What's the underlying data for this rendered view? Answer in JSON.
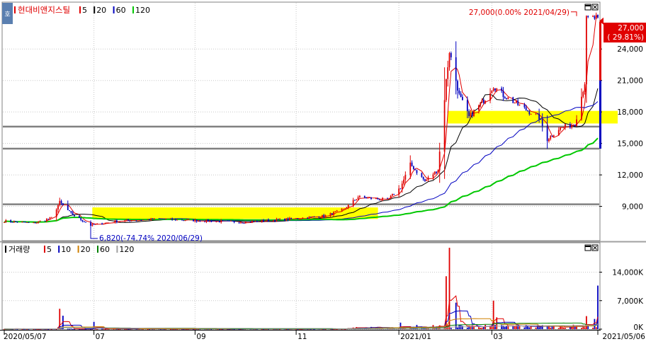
{
  "stock_name": "현대비앤지스틸",
  "price_legend": [
    {
      "label": "5",
      "color": "#e00000"
    },
    {
      "label": "20",
      "color": "#000000"
    },
    {
      "label": "60",
      "color": "#0000c0"
    },
    {
      "label": "120",
      "color": "#00c800"
    }
  ],
  "volume_title": "거래량",
  "volume_legend": [
    {
      "label": "5",
      "color": "#e00000"
    },
    {
      "label": "10",
      "color": "#0000c0"
    },
    {
      "label": "20",
      "color": "#d08000"
    },
    {
      "label": "60",
      "color": "#008000"
    },
    {
      "label": "120",
      "color": "#a0a0a0"
    }
  ],
  "hi_annotation": "27,000(0.00% 2021/04/29)",
  "lo_annotation": "6,820(-74.74% 2020/06/29)",
  "current_price": "27,000",
  "current_change": "( 29.81%)",
  "side_icon": "호",
  "chart_data": {
    "type": "candlestick",
    "price_axis": {
      "ticks": [
        9000,
        12000,
        15000,
        18000,
        21000,
        24000
      ],
      "tick_labels": [
        "9,000",
        "12,000",
        "15,000",
        "18,000",
        "21,000",
        "24,000"
      ],
      "range": [
        5800,
        28400
      ]
    },
    "volume_axis": {
      "ticks": [
        0,
        7000,
        14000
      ],
      "tick_labels": [
        "0K",
        "7,000K",
        "14,000K"
      ],
      "range": [
        0,
        20000
      ]
    },
    "x_labels": [
      {
        "label": "2020/05/07",
        "date": "2020-05-07"
      },
      {
        "label": "07",
        "date": "2020-07-01"
      },
      {
        "label": "09",
        "date": "2020-09-01"
      },
      {
        "label": "11",
        "date": "2020-11-02"
      },
      {
        "label": "2021/01",
        "date": "2021-01-04"
      },
      {
        "label": "03",
        "date": "2021-03-02"
      },
      {
        "label": "2021/05/06",
        "date": "2021-05-06"
      }
    ],
    "horizontal_lines": [
      9200,
      14500,
      16600
    ],
    "highlight_zones": [
      {
        "from": "2020-06-30",
        "to": "2020-12-10",
        "low": 7800,
        "high": 8900
      },
      {
        "from": "2021-02-03",
        "to": "2021-05-06",
        "low": 16900,
        "high": 18100
      }
    ],
    "price_keypoints": [
      {
        "date": "2020-05-07",
        "close": 7600
      },
      {
        "date": "2020-05-25",
        "close": 7400
      },
      {
        "date": "2020-06-05",
        "close": 7900
      },
      {
        "date": "2020-06-10",
        "close": 9400
      },
      {
        "date": "2020-06-17",
        "close": 8300
      },
      {
        "date": "2020-06-29",
        "close": 7200
      },
      {
        "date": "2020-07-15",
        "close": 7600
      },
      {
        "date": "2020-08-10",
        "close": 7800
      },
      {
        "date": "2020-09-10",
        "close": 7600
      },
      {
        "date": "2020-10-01",
        "close": 7500
      },
      {
        "date": "2020-10-30",
        "close": 7800
      },
      {
        "date": "2020-11-20",
        "close": 8100
      },
      {
        "date": "2020-12-01",
        "close": 8700
      },
      {
        "date": "2020-12-10",
        "close": 9900
      },
      {
        "date": "2020-12-28",
        "close": 9600
      },
      {
        "date": "2021-01-05",
        "close": 10800
      },
      {
        "date": "2021-01-11",
        "close": 13000
      },
      {
        "date": "2021-01-20",
        "close": 11400
      },
      {
        "date": "2021-01-28",
        "close": 12500
      },
      {
        "date": "2021-02-02",
        "close": 21000
      },
      {
        "date": "2021-02-04",
        "close": 23800
      },
      {
        "date": "2021-02-10",
        "close": 19600
      },
      {
        "date": "2021-02-16",
        "close": 17500
      },
      {
        "date": "2021-02-26",
        "close": 19300
      },
      {
        "date": "2021-03-03",
        "close": 20500
      },
      {
        "date": "2021-03-09",
        "close": 19600
      },
      {
        "date": "2021-03-22",
        "close": 18300
      },
      {
        "date": "2021-03-31",
        "close": 17500
      },
      {
        "date": "2021-04-05",
        "close": 15400
      },
      {
        "date": "2021-04-12",
        "close": 16400
      },
      {
        "date": "2021-04-22",
        "close": 16900
      },
      {
        "date": "2021-04-26",
        "close": 19500
      },
      {
        "date": "2021-04-28",
        "close": 20800
      },
      {
        "date": "2021-04-29",
        "close": 26800
      },
      {
        "date": "2021-05-06",
        "close": 27000
      }
    ],
    "volume_spikes": [
      {
        "date": "2020-06-10",
        "value": 5000
      },
      {
        "date": "2020-06-12",
        "value": 3300
      },
      {
        "date": "2020-07-01",
        "value": 1800
      },
      {
        "date": "2021-01-05",
        "value": 1600
      },
      {
        "date": "2021-02-02",
        "value": 13000
      },
      {
        "date": "2021-02-04",
        "value": 20000
      },
      {
        "date": "2021-02-08",
        "value": 6500
      },
      {
        "date": "2021-03-03",
        "value": 7000
      },
      {
        "date": "2021-03-05",
        "value": 2900
      },
      {
        "date": "2021-04-29",
        "value": 3200
      },
      {
        "date": "2021-05-04",
        "value": 2500
      },
      {
        "date": "2021-05-06",
        "value": 10700
      }
    ]
  }
}
